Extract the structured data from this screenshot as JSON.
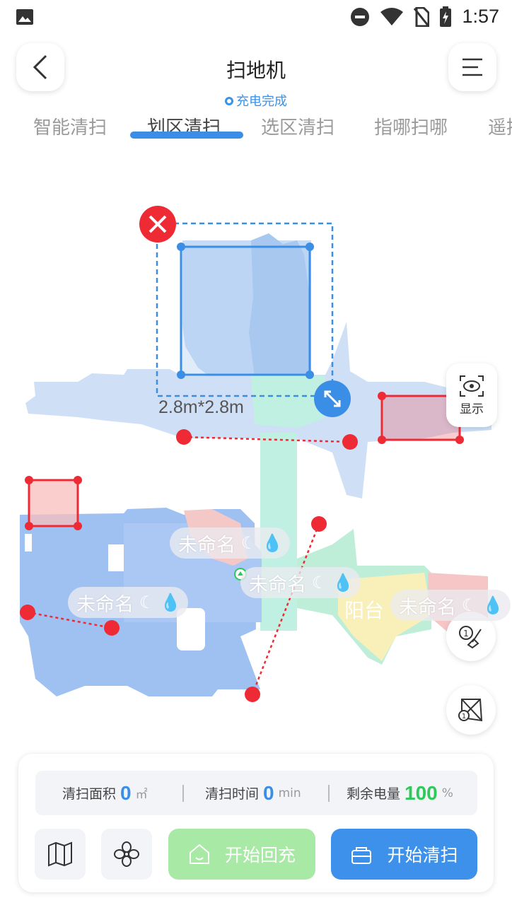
{
  "status_bar": {
    "time": "1:57"
  },
  "header": {
    "title": "扫地机",
    "status": "充电完成"
  },
  "tabs": [
    {
      "label": "智能清扫"
    },
    {
      "label": "划区清扫"
    },
    {
      "label": "选区清扫"
    },
    {
      "label": "指哪扫哪"
    },
    {
      "label": "遥控"
    }
  ],
  "map": {
    "zone_dimension": "2.8m*2.8m",
    "rooms": [
      "未命名",
      "未命名",
      "未命名",
      "阳台",
      "未命名"
    ],
    "display_label": "显示"
  },
  "stats": {
    "area_label": "清扫面积",
    "area_value": "0",
    "area_unit": "㎡",
    "time_label": "清扫时间",
    "time_value": "0",
    "time_unit": "min",
    "battery_label": "剩余电量",
    "battery_value": "100",
    "battery_unit": "%"
  },
  "actions": {
    "recharge_label": "开始回充",
    "clean_label": "开始清扫"
  },
  "colors": {
    "accent": "#3a8ee6",
    "green": "#2ec95a",
    "danger": "#ee2b35"
  }
}
